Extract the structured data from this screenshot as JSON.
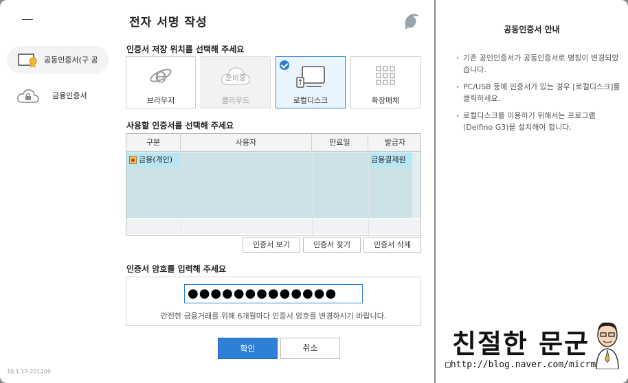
{
  "sidebar": {
    "items": [
      {
        "label": "공동인증서(구 공",
        "icon": "certificate-medal-icon",
        "active": true
      },
      {
        "label": "금융인증서",
        "icon": "cloud-lock-icon",
        "active": false
      }
    ],
    "version": "10.1.17-201209"
  },
  "main": {
    "title": "전자 서명 작성",
    "storage_label": "인증서 저장 위치를 선택해 주세요",
    "storage": [
      {
        "label": "브라우저",
        "icon": "ie-browser-icon",
        "state": "normal"
      },
      {
        "label": "클라우드",
        "icon": "cloud-icon",
        "state": "disabled",
        "badge": "준비중"
      },
      {
        "label": "로컬디스크",
        "icon": "local-disk-usb-icon",
        "state": "selected"
      },
      {
        "label": "확장매체",
        "icon": "grid-icon",
        "state": "normal"
      }
    ],
    "select_label": "사용할 인증서를 선택해 주세요",
    "table": {
      "headers": [
        "구분",
        "사용자",
        "만료일",
        "발급자"
      ],
      "rows": [
        {
          "type": "금융(개인)",
          "user": "",
          "expiry": "",
          "issuer": "금융결제원"
        }
      ]
    },
    "buttons": {
      "view": "인증서 보기",
      "find": "인증서 찾기",
      "delete": "인증서 삭제",
      "ok": "확인",
      "cancel": "취소"
    },
    "password_label": "인증서 암호를 입력해 주세요",
    "password_value": "●●●●●●●●●●●●●",
    "password_hint": "안전한 금융거래를 위해 6개월마다 인증서 암호를 변경하시기 바랍니다."
  },
  "guide": {
    "title": "공동인증서 안내",
    "items": [
      "기존 공인인증서가 공동인증서로 명칭이 변경되었습니다.",
      "PC/USB 등에 인증서가 있는 경우 [로컬디스크]를 클릭하세요.",
      "로컬디스크를 이용하기 위해서는 프로그램(Delfino G3)을 설치해야 합니다."
    ]
  },
  "watermark": {
    "brand": "친절한 문군",
    "url": "□http://blog.naver.com/micrmm"
  },
  "colors": {
    "accent": "#2e7fd6",
    "selected_row": "#cde2e6",
    "selected_cell": "#b8e7f4"
  }
}
